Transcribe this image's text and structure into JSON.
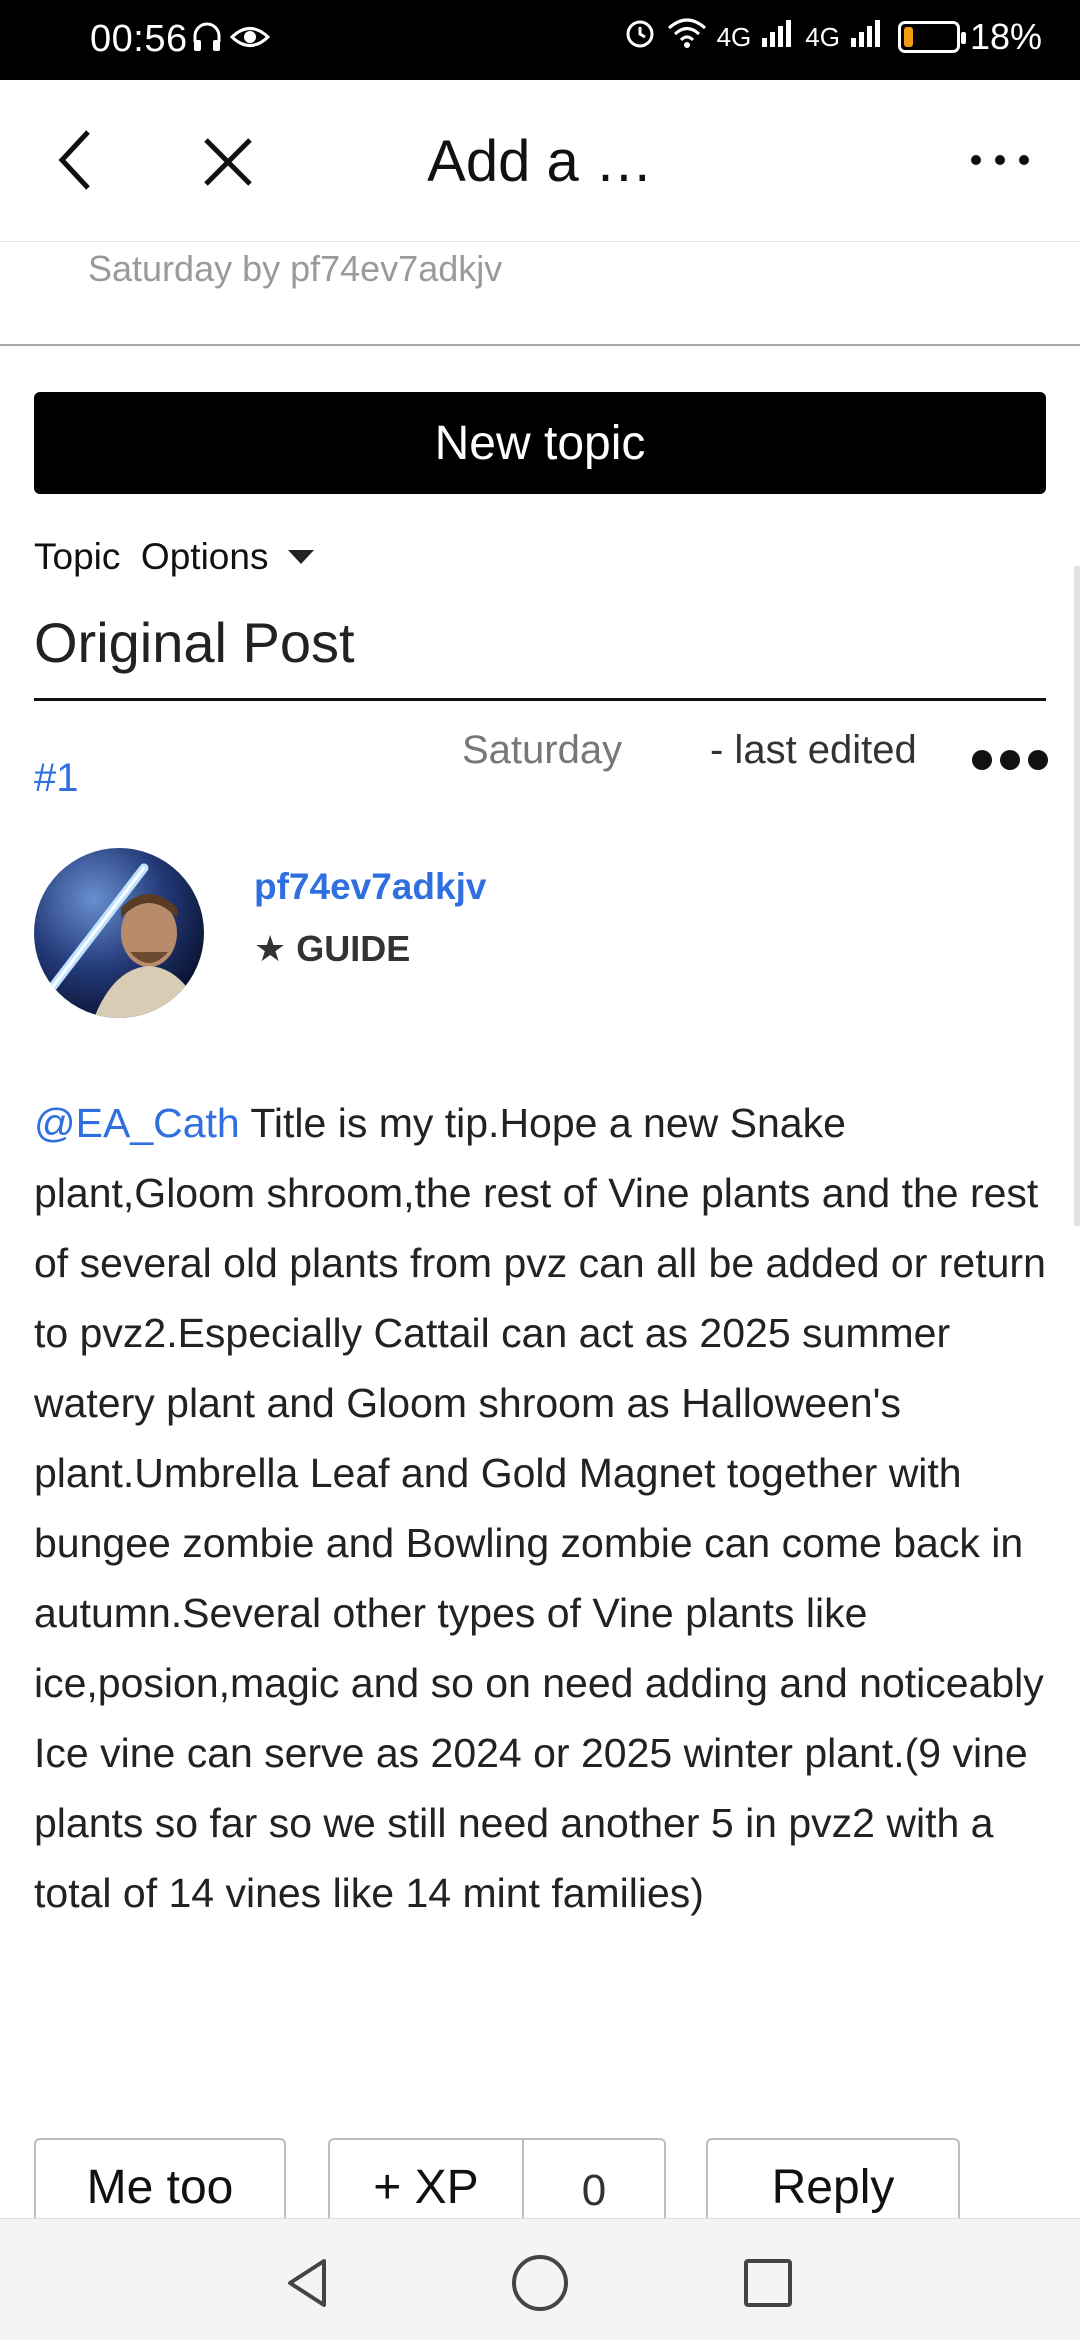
{
  "status_bar": {
    "time": "00:56",
    "network_label_1": "4G",
    "network_label_2": "4G",
    "battery_percent_text": "18%",
    "battery_level": 0.18,
    "battery_color": "#f39c12"
  },
  "header": {
    "title": "Add a …",
    "back_icon": "chevron-left-icon",
    "close_icon": "close-icon",
    "more_label": "···"
  },
  "previous_item": {
    "meta": "Saturday by pf74ev7adkjv"
  },
  "new_topic_label": "New topic",
  "topic_options_label": "Topic  Options",
  "original_post_label": "Original Post",
  "post": {
    "number": "#1",
    "date": "Saturday",
    "edited": "- last edited",
    "author": "pf74ev7adkjv",
    "rank_star": "★",
    "rank": "GUIDE",
    "mention": "@EA_Cath",
    "body": " Title is my tip.Hope a new Snake plant,Gloom shroom,the rest of Vine plants and the rest of several old plants from pvz can all be added or return to pvz2.Especially Cattail can act as 2025 summer watery plant and Gloom shroom as Halloween's plant.Umbrella Leaf and Gold Magnet together with bungee zombie and Bowling zombie can come back in autumn.Several other types of Vine plants like ice,posion,magic and so on need adding and noticeably Ice vine can serve as 2024 or 2025 winter plant.(9 vine plants so far so we still need another 5 in pvz2 with a total of 14 vines like 14 mint families)"
  },
  "actions": {
    "me_too": "Me too",
    "xp": "+ XP",
    "xp_count": "0",
    "reply": "Reply"
  },
  "colors": {
    "accent_link": "#2f6fe0",
    "button_black": "#000000"
  }
}
